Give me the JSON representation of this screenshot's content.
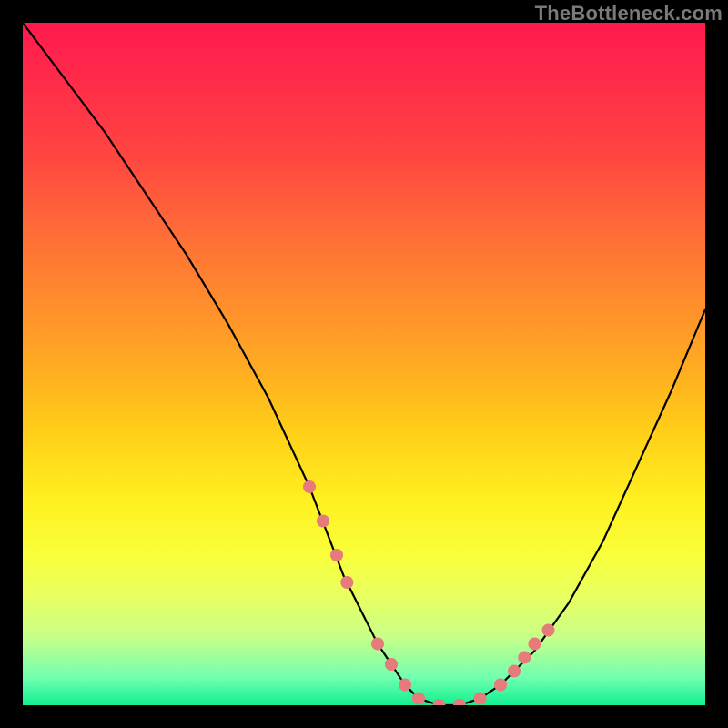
{
  "watermark": "TheBottleneck.com",
  "chart_data": {
    "type": "line",
    "title": "",
    "xlabel": "",
    "ylabel": "",
    "ylim": [
      0,
      100
    ],
    "xlim": [
      0,
      100
    ],
    "series": [
      {
        "name": "curve",
        "x": [
          0,
          6,
          12,
          18,
          24,
          30,
          36,
          42,
          47,
          52,
          56,
          58,
          61,
          64,
          67,
          70,
          75,
          80,
          85,
          90,
          95,
          100
        ],
        "y": [
          100,
          92,
          84,
          75,
          66,
          56,
          45,
          32,
          19,
          9,
          3,
          1,
          0,
          0,
          1,
          3,
          8,
          15,
          24,
          35,
          46,
          58
        ]
      }
    ],
    "markers": {
      "name": "dots",
      "color": "#e77a7a",
      "x": [
        42,
        44,
        46,
        47.5,
        52,
        54,
        56,
        58,
        61,
        64,
        67,
        70,
        72,
        73.5,
        75,
        77
      ],
      "y": [
        32,
        27,
        22,
        18,
        9,
        6,
        3,
        1,
        0,
        0,
        1,
        3,
        5,
        7,
        9,
        11
      ]
    },
    "legend": false,
    "grid": false
  }
}
